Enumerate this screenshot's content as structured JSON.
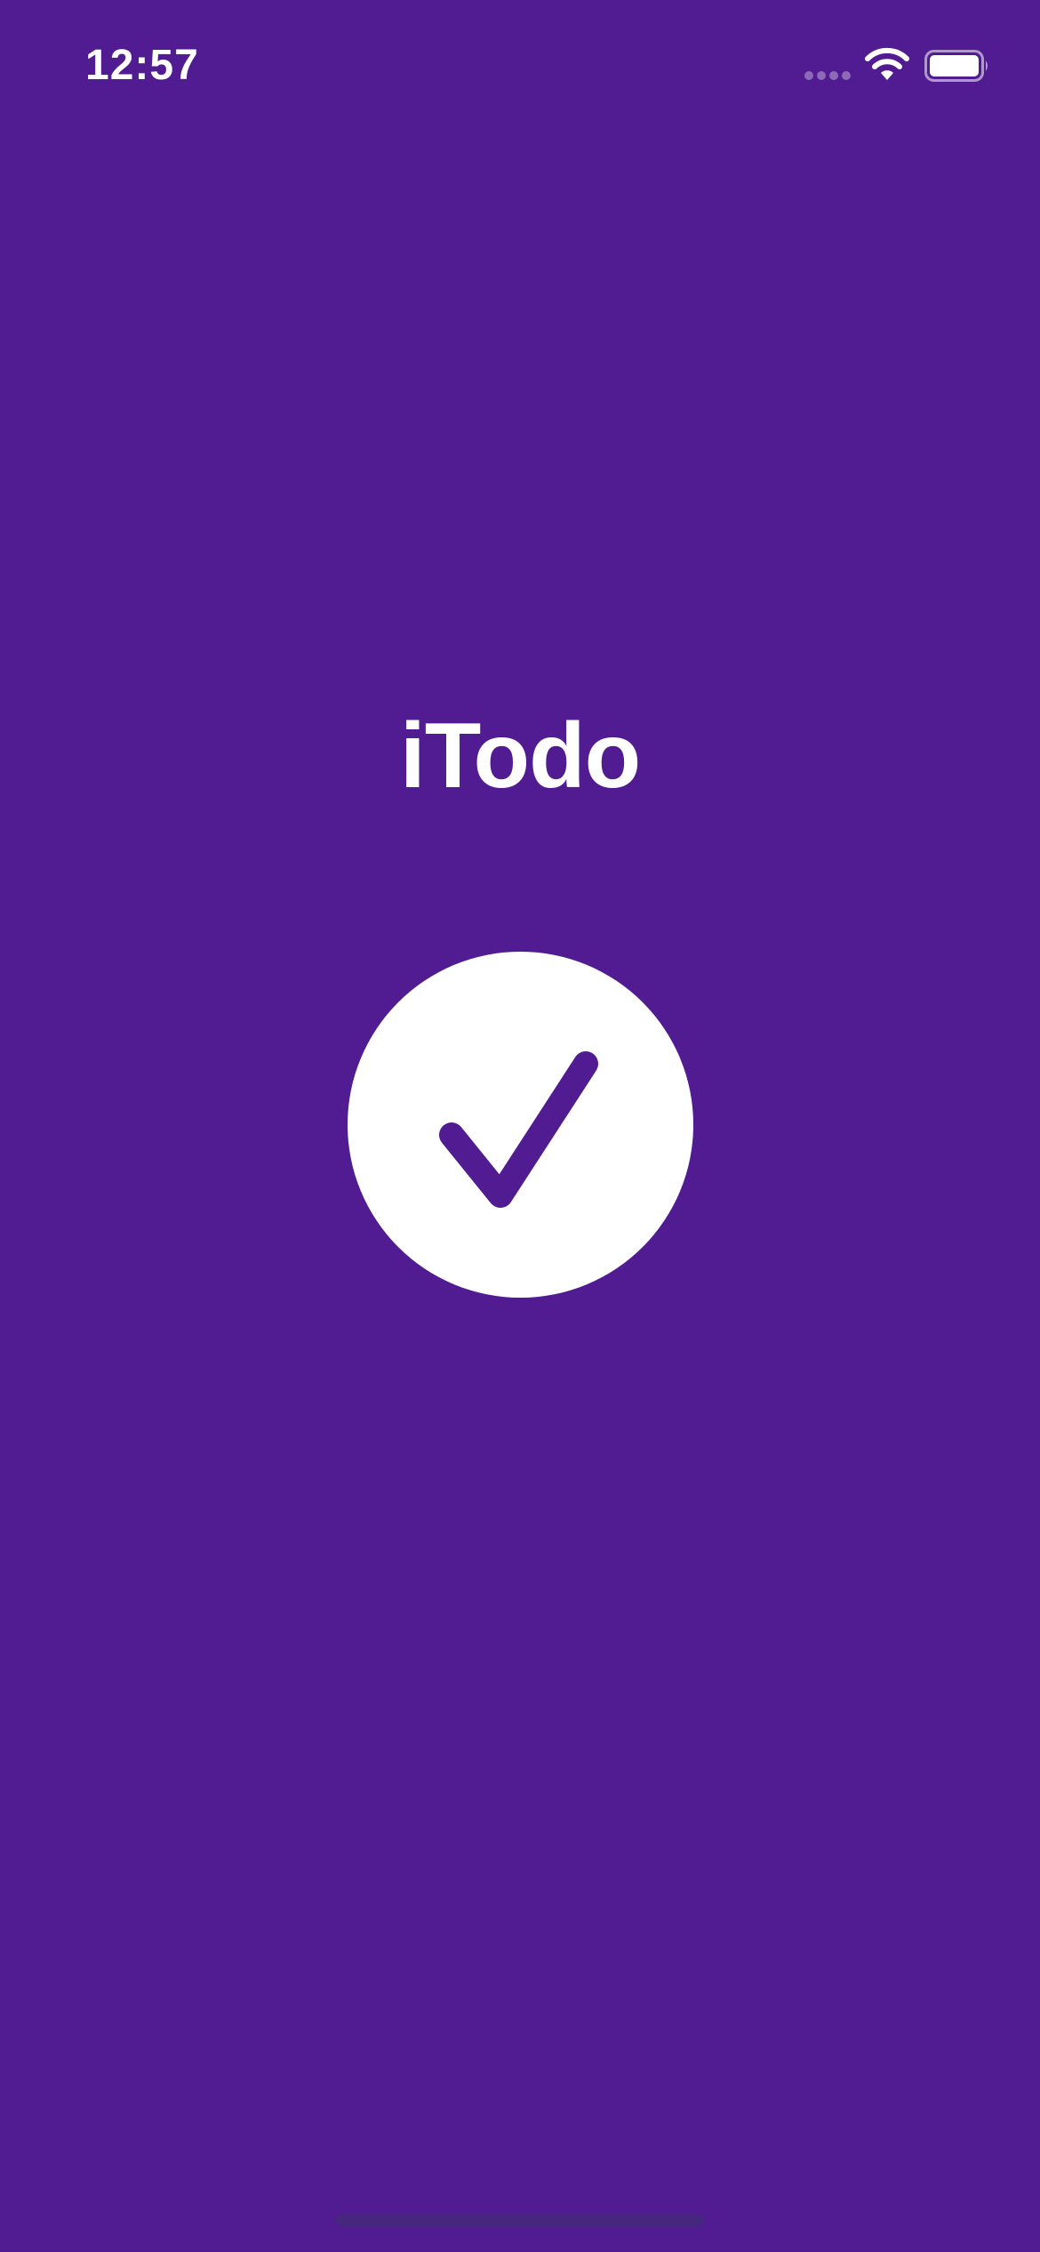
{
  "status_bar": {
    "time": "12:57",
    "icons": [
      "cellular-signal-icon",
      "wifi-icon",
      "battery-icon"
    ]
  },
  "splash": {
    "title": "iTodo",
    "logo_icon": "checkmark-icon"
  },
  "colors": {
    "background": "#511B92",
    "foreground": "#FFFFFF",
    "home_indicator": "#3C326E"
  }
}
